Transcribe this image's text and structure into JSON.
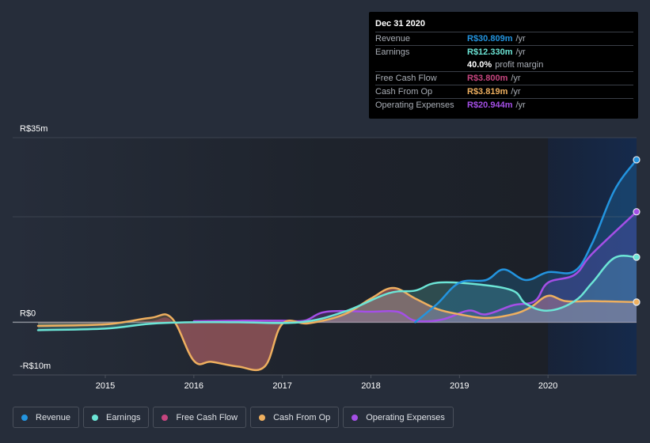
{
  "tooltip": {
    "date": "Dec 31 2020",
    "rows": [
      {
        "label": "Revenue",
        "value": "R$30.809m",
        "unit": "/yr",
        "color": "#2394df"
      },
      {
        "label": "Earnings",
        "value": "R$12.330m",
        "unit": "/yr",
        "color": "#6ce5d6"
      },
      {
        "label": "",
        "value": "40.0%",
        "unit": "profit margin",
        "color": "#ffffff"
      },
      {
        "label": "Free Cash Flow",
        "value": "R$3.800m",
        "unit": "/yr",
        "color": "#c6457f"
      },
      {
        "label": "Cash From Op",
        "value": "R$3.819m",
        "unit": "/yr",
        "color": "#eeaf5f"
      },
      {
        "label": "Operating Expenses",
        "value": "R$20.944m",
        "unit": "/yr",
        "color": "#a44fe6"
      }
    ]
  },
  "legend": [
    {
      "label": "Revenue",
      "color": "#2394df"
    },
    {
      "label": "Earnings",
      "color": "#6ce5d6"
    },
    {
      "label": "Free Cash Flow",
      "color": "#c6457f"
    },
    {
      "label": "Cash From Op",
      "color": "#eeaf5f"
    },
    {
      "label": "Operating Expenses",
      "color": "#a44fe6"
    }
  ],
  "chart_data": {
    "type": "area",
    "title": "",
    "xlabel": "",
    "ylabel": "",
    "xlim": [
      2014.24,
      2021.0
    ],
    "ylim": [
      -10,
      35
    ],
    "y_ticks": [
      {
        "value": 35,
        "label": "R$35m"
      },
      {
        "value": 0,
        "label": "R$0"
      },
      {
        "value": -10,
        "label": "-R$10m"
      }
    ],
    "gridlines": [
      35,
      20,
      0,
      -10
    ],
    "x_ticks": [
      {
        "value": 2015,
        "label": "2015"
      },
      {
        "value": 2016,
        "label": "2016"
      },
      {
        "value": 2017,
        "label": "2017"
      },
      {
        "value": 2018,
        "label": "2018"
      },
      {
        "value": 2019,
        "label": "2019"
      },
      {
        "value": 2020,
        "label": "2020"
      }
    ],
    "highlight_range": [
      2020.0,
      2021.0
    ],
    "legend_position": "bottom-left",
    "series": [
      {
        "name": "Free Cash Flow",
        "key": "fcf",
        "color": "#c6457f",
        "line": false,
        "x": [
          2014.24,
          2015.0,
          2015.5,
          2015.75,
          2016.0,
          2016.2,
          2016.5,
          2016.8,
          2017.0,
          2017.3,
          2017.7,
          2018.0,
          2018.25,
          2018.5,
          2018.75,
          2019.0,
          2019.3,
          2019.6,
          2019.8,
          2020.0,
          2020.2,
          2020.5,
          2021.0
        ],
        "values": [
          -0.2,
          -0.2,
          0.2,
          0.3,
          -7.3,
          -7.5,
          -8.3,
          -8.3,
          -0.3,
          -0.2,
          1.4,
          4.4,
          6.4,
          4.4,
          2.4,
          1.4,
          0.7,
          1.4,
          2.7,
          4.9,
          3.9,
          3.9,
          3.8
        ]
      },
      {
        "name": "Operating Expenses",
        "key": "opex",
        "color": "#a44fe6",
        "line": true,
        "x": [
          2016.0,
          2016.5,
          2017.0,
          2017.25,
          2017.5,
          2018.0,
          2018.3,
          2018.5,
          2018.8,
          2019.1,
          2019.3,
          2019.6,
          2019.85,
          2020.0,
          2020.3,
          2020.5,
          2021.0
        ],
        "values": [
          0.2,
          0.3,
          0.3,
          0.3,
          2.0,
          2.0,
          2.0,
          0.3,
          0.5,
          2.2,
          1.5,
          3.2,
          4.0,
          7.5,
          9.0,
          13.0,
          20.944
        ]
      },
      {
        "name": "Cash From Op",
        "key": "cfo",
        "color": "#eeaf5f",
        "line": true,
        "x": [
          2014.24,
          2015.0,
          2015.5,
          2015.75,
          2016.0,
          2016.2,
          2016.5,
          2016.8,
          2017.0,
          2017.3,
          2017.7,
          2018.0,
          2018.25,
          2018.5,
          2018.75,
          2019.0,
          2019.3,
          2019.6,
          2019.8,
          2020.0,
          2020.2,
          2020.5,
          2021.0
        ],
        "values": [
          -0.7,
          -0.4,
          0.8,
          0.8,
          -7.3,
          -7.5,
          -8.4,
          -8.4,
          -0.3,
          -0.2,
          1.5,
          4.5,
          6.5,
          4.5,
          2.5,
          1.5,
          0.8,
          1.5,
          2.8,
          5.0,
          4.0,
          4.0,
          3.819
        ]
      },
      {
        "name": "Earnings",
        "key": "earnings",
        "color": "#6ce5d6",
        "line": true,
        "x": [
          2014.24,
          2015.0,
          2015.5,
          2016.0,
          2016.5,
          2017.2,
          2017.7,
          2018.2,
          2018.5,
          2018.75,
          2019.2,
          2019.6,
          2019.75,
          2020.0,
          2020.3,
          2020.5,
          2020.75,
          2021.0
        ],
        "values": [
          -1.5,
          -1.2,
          -0.3,
          0.0,
          0.0,
          0.0,
          2.0,
          5.5,
          6.0,
          7.5,
          7.2,
          6.0,
          3.5,
          2.2,
          4.0,
          7.5,
          12.2,
          12.33
        ]
      },
      {
        "name": "Revenue",
        "key": "revenue",
        "color": "#2394df",
        "line": true,
        "x": [
          2018.5,
          2018.75,
          2019.0,
          2019.3,
          2019.5,
          2019.75,
          2020.0,
          2020.3,
          2020.5,
          2020.75,
          2021.0
        ],
        "values": [
          0.0,
          3.5,
          7.5,
          8.0,
          10.0,
          8.0,
          9.5,
          9.7,
          15.0,
          25.0,
          30.809
        ]
      }
    ]
  }
}
